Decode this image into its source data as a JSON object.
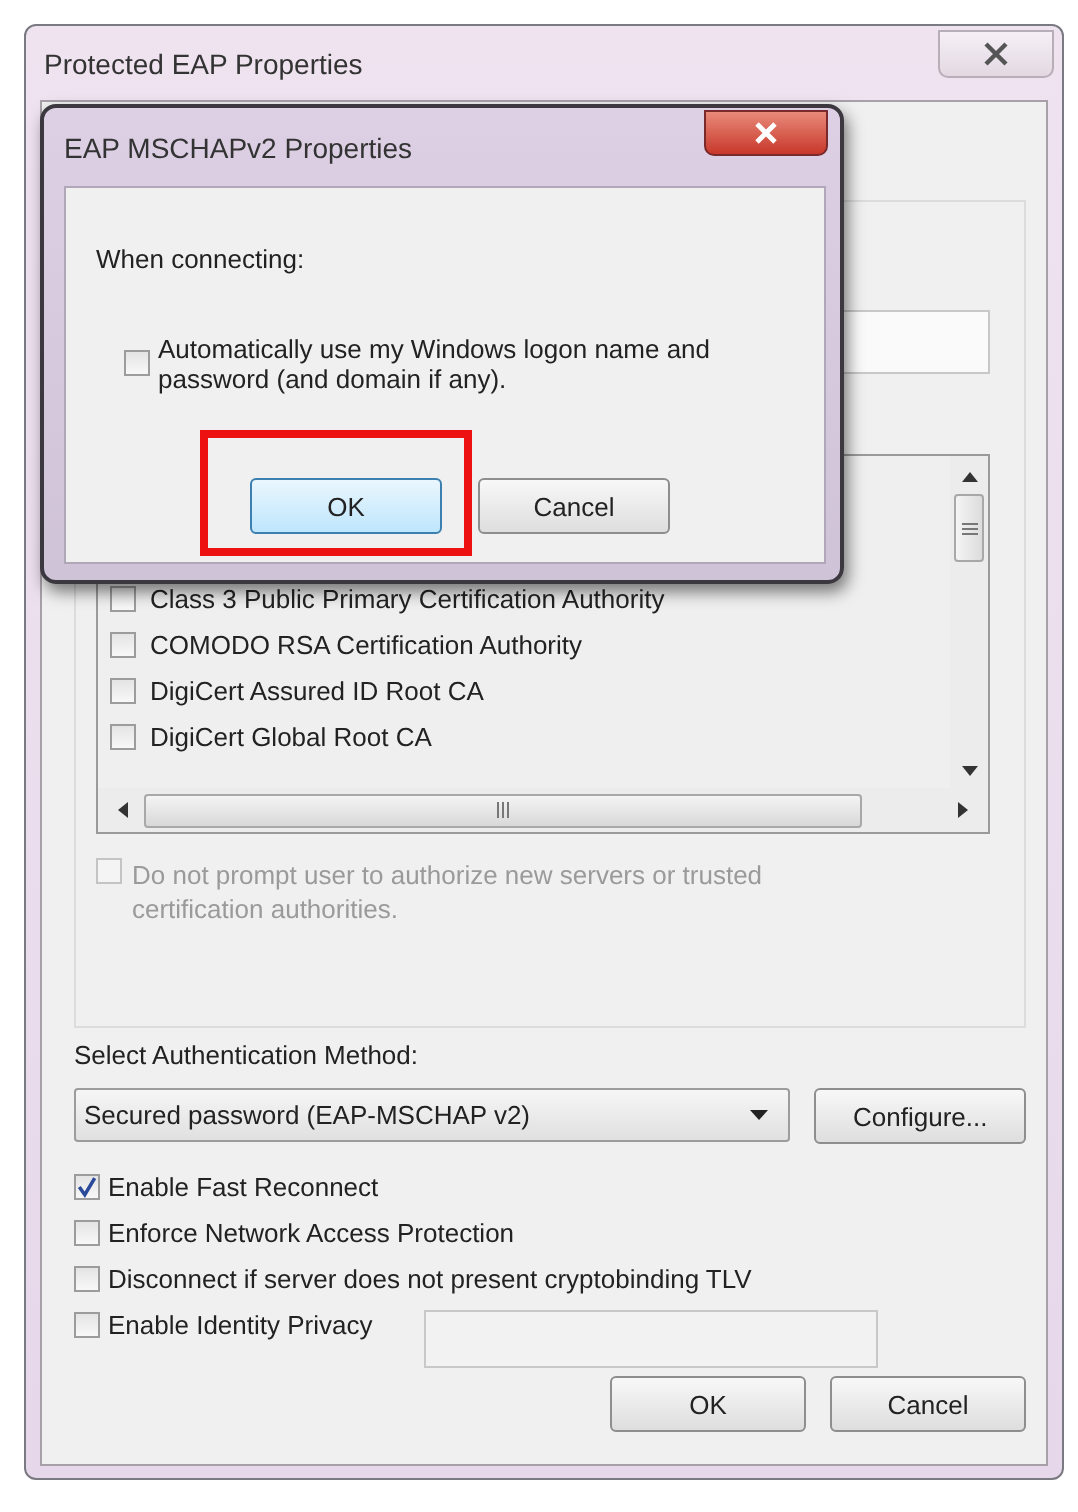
{
  "window": {
    "title": "Protected EAP Properties"
  },
  "certificate_list": {
    "items": [
      {
        "label": "Class 3 Public Primary Certification Authority",
        "checked": false
      },
      {
        "label": "COMODO RSA Certification Authority",
        "checked": false
      },
      {
        "label": "DigiCert Assured ID Root CA",
        "checked": false
      },
      {
        "label": "DigiCert Global Root CA",
        "checked": false
      }
    ]
  },
  "prompt_option": {
    "label": "Do not prompt user to authorize new servers or trusted certification authorities.",
    "checked": false,
    "disabled": true
  },
  "auth_method": {
    "label": "Select Authentication Method:",
    "value": "Secured password (EAP-MSCHAP v2)",
    "button": "Configure..."
  },
  "options": [
    {
      "kind": "checkbox",
      "label": "Enable Fast Reconnect",
      "checked": true
    },
    {
      "kind": "checkbox",
      "label": "Enforce Network Access Protection",
      "checked": false
    },
    {
      "kind": "checkbox",
      "label": "Disconnect if server does not present cryptobinding TLV",
      "checked": false
    },
    {
      "kind": "checkbox_field",
      "label": "Enable Identity Privacy",
      "checked": false
    }
  ],
  "buttons": [
    {
      "label": "OK"
    },
    {
      "label": "Cancel"
    }
  ],
  "dialog": {
    "title": "EAP MSCHAPv2 Properties",
    "section_label": "When connecting:",
    "option": {
      "label": "Automatically use my Windows logon name and password (and domain if any).",
      "checked": false
    },
    "buttons": [
      {
        "label": "OK",
        "highlighted": true
      },
      {
        "label": "Cancel",
        "highlighted": false
      }
    ]
  }
}
